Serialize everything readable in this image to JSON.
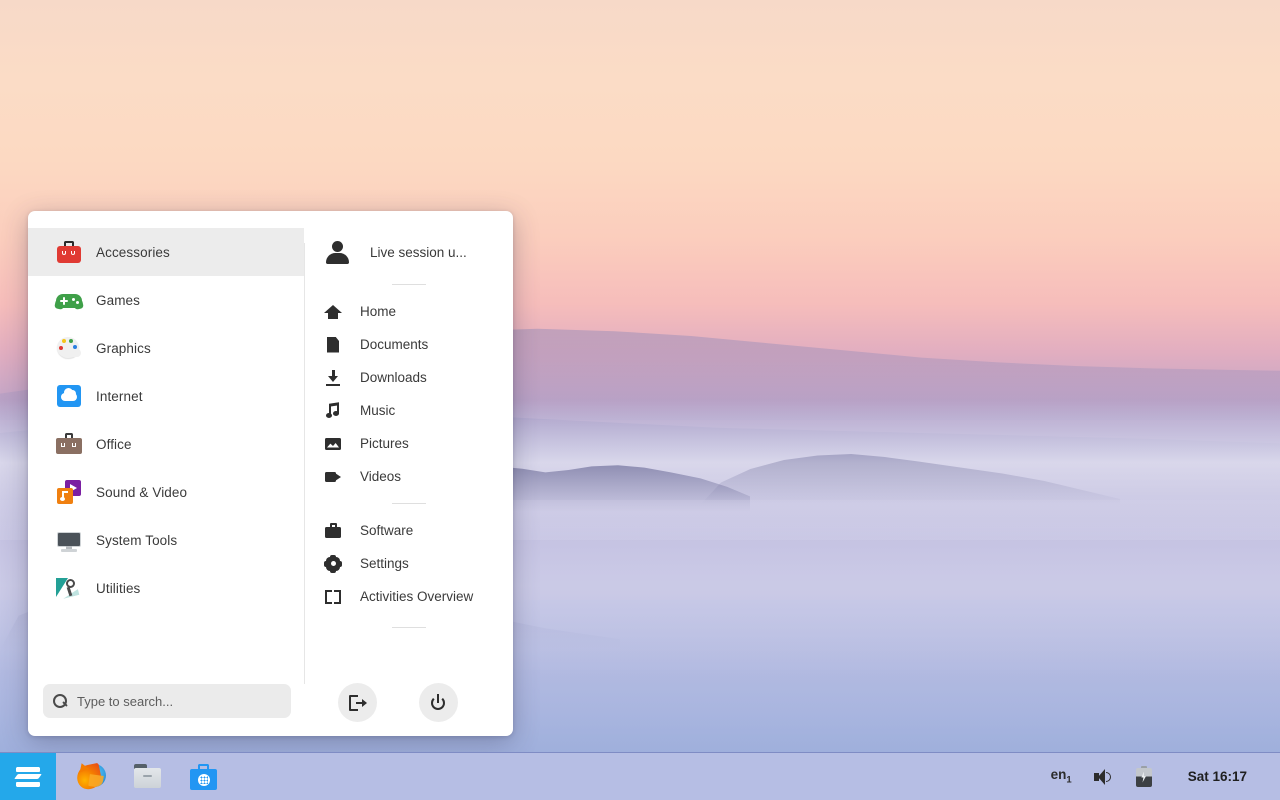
{
  "menu": {
    "categories": [
      {
        "label": "Accessories",
        "icon": "toolbox-icon",
        "selected": true
      },
      {
        "label": "Games",
        "icon": "gamepad-icon",
        "selected": false
      },
      {
        "label": "Graphics",
        "icon": "palette-icon",
        "selected": false
      },
      {
        "label": "Internet",
        "icon": "cloud-icon",
        "selected": false
      },
      {
        "label": "Office",
        "icon": "briefcase-icon",
        "selected": false
      },
      {
        "label": "Sound & Video",
        "icon": "media-icon",
        "selected": false
      },
      {
        "label": "System Tools",
        "icon": "monitor-icon",
        "selected": false
      },
      {
        "label": "Utilities",
        "icon": "wrench-flag-icon",
        "selected": false
      }
    ],
    "search": {
      "placeholder": "Type to search...",
      "value": "",
      "icon": "search-icon"
    },
    "user": {
      "name": "Live session u...",
      "icon": "user-avatar-icon"
    },
    "places": [
      {
        "label": "Home",
        "icon": "home-icon"
      },
      {
        "label": "Documents",
        "icon": "document-icon"
      },
      {
        "label": "Downloads",
        "icon": "download-icon"
      },
      {
        "label": "Music",
        "icon": "music-note-icon"
      },
      {
        "label": "Pictures",
        "icon": "picture-icon"
      },
      {
        "label": "Videos",
        "icon": "video-camera-icon"
      }
    ],
    "system": [
      {
        "label": "Software",
        "icon": "briefcase-icon"
      },
      {
        "label": "Settings",
        "icon": "gear-icon"
      },
      {
        "label": "Activities Overview",
        "icon": "activities-icon"
      }
    ],
    "actions": [
      {
        "name": "logout",
        "icon": "logout-icon"
      },
      {
        "name": "power",
        "icon": "power-icon"
      }
    ]
  },
  "taskbar": {
    "start_button": {
      "name": "zorin-menu-button",
      "icon": "zorin-logo-icon"
    },
    "launchers": [
      {
        "name": "firefox",
        "icon": "firefox-icon"
      },
      {
        "name": "files",
        "icon": "file-manager-icon"
      },
      {
        "name": "software",
        "icon": "software-store-icon"
      }
    ],
    "tray": {
      "keyboard_layout": "en",
      "keyboard_layout_index": "1",
      "volume_icon": "volume-icon",
      "battery_icon": "battery-charging-icon",
      "clock": "Sat 16:17"
    }
  },
  "colors": {
    "accent": "#24a8ea",
    "panel_bg": "#ffffff",
    "selected_row": "#ececec",
    "taskbar_bg": "#b6bee4",
    "search_bg": "#ebebeb"
  }
}
